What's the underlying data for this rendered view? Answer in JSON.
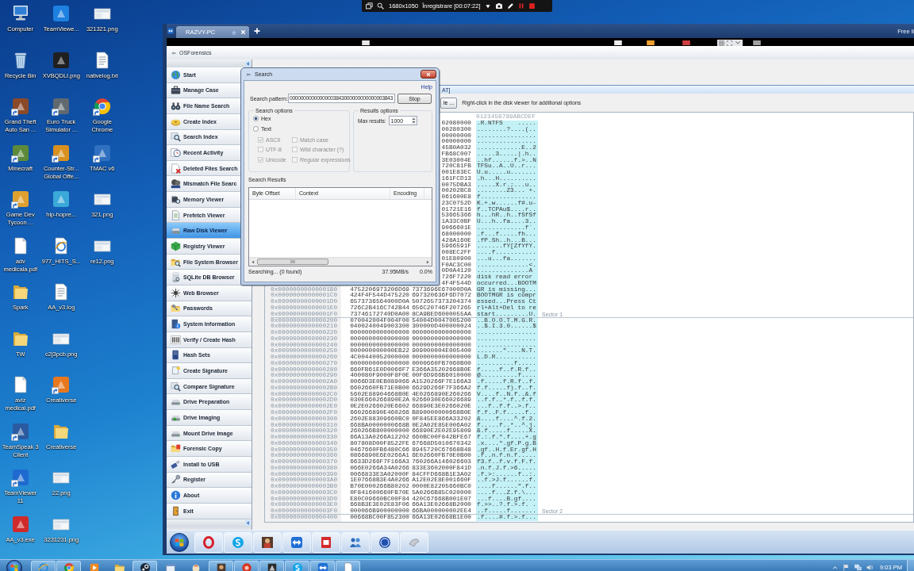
{
  "recording_bar": {
    "resolution": "1680x1050",
    "status": "Înregistrare [00:07:22]"
  },
  "desktop": {
    "columns": [
      {
        "icons": [
          {
            "label": "Computer",
            "kind": "computer",
            "shortcut": false
          },
          {
            "label": "Recycle Bin",
            "kind": "recycle-bin",
            "shortcut": false
          },
          {
            "label": "Grand Theft Auto San ...",
            "kind": "app",
            "color": "#8a4a2a",
            "shortcut": true
          },
          {
            "label": "Minecraft",
            "kind": "app",
            "color": "#5c8a3a",
            "shortcut": true
          },
          {
            "label": "Game Dev Tycoon ...",
            "kind": "app",
            "color": "#e0a030",
            "shortcut": true
          },
          {
            "label": "adv medicala.pdf",
            "kind": "blank-file",
            "shortcut": false
          },
          {
            "label": "Spark",
            "kind": "folder",
            "shortcut": false
          },
          {
            "label": "TW",
            "kind": "folder",
            "shortcut": false
          },
          {
            "label": "aviz medical.pdf",
            "kind": "blank-file",
            "shortcut": false
          },
          {
            "label": "TeamSpeak 3 Client",
            "kind": "app",
            "color": "#2a5aa0",
            "shortcut": true
          },
          {
            "label": "TeamViewer 11",
            "kind": "app",
            "color": "#1e6ad0",
            "shortcut": true
          },
          {
            "label": "AA_v3.exe",
            "kind": "app",
            "color": "#d02a2a",
            "shortcut": false
          }
        ]
      },
      {
        "icons": [
          {
            "label": "TeamViewe...",
            "kind": "app",
            "color": "#1e80e0",
            "shortcut": false
          },
          {
            "label": "XVBQDLI.png",
            "kind": "app",
            "color": "#202020",
            "shortcut": false
          },
          {
            "label": "Euro Truck Simulator ...",
            "kind": "app",
            "color": "#606870",
            "shortcut": true
          },
          {
            "label": "Counter-Str... Global Offe...",
            "kind": "app",
            "color": "#d89020",
            "shortcut": true
          },
          {
            "label": "hip-hopre...",
            "kind": "app",
            "color": "#3aa8d8",
            "shortcut": false
          },
          {
            "label": "977_HITS_S...",
            "kind": "web-file",
            "shortcut": false
          },
          {
            "label": "AA_v3.log",
            "kind": "text-file",
            "shortcut": false
          },
          {
            "label": "c2j3pcb.png",
            "kind": "image-file",
            "shortcut": false
          },
          {
            "label": "Creativerse",
            "kind": "app",
            "color": "#e87820",
            "shortcut": true
          },
          {
            "label": "Creativerse",
            "kind": "folder",
            "shortcut": false
          },
          {
            "label": "22.png",
            "kind": "image-file",
            "shortcut": false
          },
          {
            "label": "3231231.png",
            "kind": "image-file",
            "shortcut": false
          }
        ]
      },
      {
        "icons": [
          {
            "label": "321321.png",
            "kind": "image-file",
            "shortcut": false
          },
          {
            "label": "nativelog.txt",
            "kind": "text-file",
            "shortcut": false
          },
          {
            "label": "Google Chrome",
            "kind": "chrome",
            "shortcut": true
          },
          {
            "label": "TMAC v6",
            "kind": "app",
            "color": "#3070c0",
            "shortcut": true
          },
          {
            "label": "321.png",
            "kind": "image-file",
            "shortcut": false
          },
          {
            "label": "re12.png",
            "kind": "image-file",
            "shortcut": false
          }
        ]
      }
    ]
  },
  "remote_window": {
    "tabs": [
      {
        "label": "RAZVY-PC",
        "selected": true
      }
    ],
    "license_notice": "Free li",
    "app": {
      "title": "OSForensics",
      "sidebar": [
        {
          "label": "Start",
          "selected": false
        },
        {
          "label": "Manage Case",
          "selected": false
        },
        {
          "label": "File Name Search",
          "selected": false
        },
        {
          "label": "Create Index",
          "selected": false
        },
        {
          "label": "Search Index",
          "selected": false
        },
        {
          "label": "Recent Activity",
          "selected": false
        },
        {
          "label": "Deleted Files Search",
          "selected": false
        },
        {
          "label": "Mismatch File Searc",
          "selected": false
        },
        {
          "label": "Memory Viewer",
          "selected": false
        },
        {
          "label": "Prefetch Viewer",
          "selected": false
        },
        {
          "label": "Raw Disk Viewer",
          "selected": true
        },
        {
          "label": "Registry Viewer",
          "selected": false
        },
        {
          "label": "File System Browser",
          "selected": false
        },
        {
          "label": "SQLite DB Browser",
          "selected": false
        },
        {
          "label": "Web Browser",
          "selected": false
        },
        {
          "label": "Passwords",
          "selected": false
        },
        {
          "label": "System Information",
          "selected": false
        },
        {
          "label": "Verify / Create Hash",
          "selected": false
        },
        {
          "label": "Hash Sets",
          "selected": false
        },
        {
          "label": "Create Signature",
          "selected": false
        },
        {
          "label": "Compare Signature",
          "selected": false
        },
        {
          "label": "Drive Preparation",
          "selected": false
        },
        {
          "label": "Drive Imaging",
          "selected": false
        },
        {
          "label": "Mount Drive Image",
          "selected": false
        },
        {
          "label": "Forensic Copy",
          "selected": false
        },
        {
          "label": "Install to USB",
          "selected": false
        },
        {
          "label": "Register",
          "selected": false
        },
        {
          "label": "About",
          "selected": false
        },
        {
          "label": "Exit",
          "selected": false
        }
      ],
      "viewer_title": "AT]",
      "toolbar_button": "le ...",
      "toolbar_hint": "Right-click in the disk viewer for additional options",
      "hex_view": {
        "header": "0123456789ABCDEF",
        "rows": [
          {
            "hex_2": "02080000",
            "ascii": ".R.NTFS    ....."
          },
          {
            "hex_2": "00280300",
            "ascii": "........?....(.."
          },
          {
            "hex_2": "00000000",
            "ascii": "................"
          },
          {
            "hex_2": "00000000",
            "ascii": "................"
          },
          {
            "hex_2": "45B0A032",
            "ascii": "............E..2"
          },
          {
            "hex_2": "FB68C007",
            "ascii": ".....3.....|.h.."
          },
          {
            "hex_2": "3E03004E",
            "ascii": "..hf......f.>..N"
          },
          {
            "hex_2": "720C81FB",
            "ascii": "TFSu..A..U..r..."
          },
          {
            "hex_2": "001E83EC",
            "ascii": "U.u.....u......."
          },
          {
            "hex_2": "161FCD13",
            "ascii": ".h...H.........."
          },
          {
            "hex_2": "0075DBA3",
            "ascii": ".....X.r.;...u.."
          },
          {
            "hex_2": "00202BC8",
            "ascii": "........Z3... +."
          },
          {
            "hex_2": "061600E8",
            "ascii": "f..............."
          },
          {
            "hex_2": "23C0752D",
            "ascii": "K.+.w......f#.u-"
          },
          {
            "hex_2": "01721E16",
            "ascii": "f..TCPAu$....r.."
          },
          {
            "hex_2": "53665366",
            "ascii": "h...hR..h..fSfSf"
          },
          {
            "hex_2": "1A33C0BF",
            "ascii": "U...h..fa....3.."
          },
          {
            "hex_2": "9066601E",
            "ascii": ".............f`."
          },
          {
            "hex_2": "68000000",
            "ascii": ".f...f.....fh..."
          },
          {
            "hex_2": "428A160E",
            "ascii": ".fP.Sh..h...B..."
          },
          {
            "hex_2": "5966591F",
            "ascii": ".......fY[ZfYfY."
          },
          {
            "hex_2": "008EC2FF",
            "ascii": "....f..........."
          },
          {
            "hex_2": "01E80900",
            "ascii": "...u...fa......."
          },
          {
            "hex_2": "F0AC3C00",
            "ascii": "..............<."
          },
          {
            "hex_2": "0D0A4120",
            "ascii": "..............A "
          },
          {
            "hex_2": "726F7220",
            "ascii": "disk read error "
          },
          {
            "hex_2": "4F4F544D",
            "ascii": "occurred...BOOTM"
          },
          {
            "offset": "0x00000000000001B0",
            "hex_1": "4752206973206D69",
            "hex_2": "7373696E67000D0A",
            "ascii": "GR is missing..."
          },
          {
            "offset": "0x00000000000001C0",
            "hex_1": "424F4F544D475220",
            "hex_2": "697320636F6D7072",
            "ascii": "BOOTMGR is compr"
          },
          {
            "offset": "0x00000000000001D0",
            "hex_1": "6573736564000D0A",
            "hex_2": "5072657373204374",
            "ascii": "essed...Press Ct"
          },
          {
            "offset": "0x00000000000001E0",
            "hex_1": "726C2B416C742B44",
            "hex_2": "656C20746F207265",
            "ascii": "rl+Alt+Del to re"
          },
          {
            "offset": "0x00000000000001F0",
            "hex_1": "73746172740D0A00",
            "hex_2": "8CA9BED6000055AA",
            "ascii": "start.........U.",
            "sector_label": "Sector 1"
          },
          {
            "offset": "0x0000000000000200",
            "hex_1": "070042004F004F00",
            "hex_2": "54004D0047005200",
            "ascii": "..B.O.O.T.M.G.R."
          },
          {
            "offset": "0x0000000000000210",
            "hex_1": "0400240049003300",
            "hex_2": "300000D400000024",
            "ascii": "..$.I.3.0......$"
          },
          {
            "offset": "0x0000000000000220",
            "hex_1": "0000000000000000",
            "hex_2": "0000000000000000",
            "ascii": "................"
          },
          {
            "offset": "0x0000000000000230",
            "hex_1": "0000000000000000",
            "hex_2": "0000000000000000",
            "ascii": "................"
          },
          {
            "offset": "0x0000000000000240",
            "hex_1": "0000000000000000",
            "hex_2": "0000000000000000",
            "ascii": "................"
          },
          {
            "offset": "0x0000000000000250",
            "hex_1": "000000000000EB22",
            "hex_2": "909000004E005400",
            "ascii": ".......\"....N.T."
          },
          {
            "offset": "0x0000000000000260",
            "hex_1": "4C00440052000000",
            "hex_2": "0000000000000000",
            "ascii": "L.D.R..........."
          },
          {
            "offset": "0x0000000000000270",
            "hex_1": "0000000000000000",
            "hex_2": "0000660FB7060B00",
            "ascii": "..........f....."
          },
          {
            "offset": "0x0000000000000280",
            "hex_1": "660FB61E0D0066F7",
            "hex_2": "E366A35202668B0E",
            "ascii": "f.....f..f.R.f.."
          },
          {
            "offset": "0x0000000000000290",
            "hex_1": "400080F9000F8F0E",
            "hex_2": "00F6D966B6010000",
            "ascii": "@..........f...."
          },
          {
            "offset": "0x00000000000002A0",
            "hex_1": "0066D3E0EB089066",
            "hex_2": "A1520266F7E166A3",
            "ascii": ".f.....f.R.f..f."
          },
          {
            "offset": "0x00000000000002B0",
            "hex_1": "6602660FB71E0B00",
            "hex_2": "6629D266F7F366A2",
            "ascii": "f.f.....f).f..f."
          },
          {
            "offset": "0x00000000000002C0",
            "hex_1": "5602E88904668B0E",
            "hex_2": "4E0266890E260266",
            "ascii": "V....f..N.f..&.f"
          },
          {
            "offset": "0x00000000000002D0",
            "hex_1": "030E660266890E2A",
            "hex_2": "0266030E66026689",
            "ascii": "..f.f..*.f..f.f."
          },
          {
            "offset": "0x00000000000002E0",
            "hex_1": "0E2E0266020E6602",
            "hex_2": "66890E3E0266020E",
            "ascii": "...f..f.f..>.f.."
          },
          {
            "offset": "0x00000000000002F0",
            "hex_1": "660266890E460266",
            "hex_2": "B890000000668B0E",
            "ascii": "f.f..F.f.....f.."
          },
          {
            "offset": "0x0000000000000300",
            "hex_1": "2602E88309660BC0",
            "hex_2": "0F845EE866A33202",
            "ascii": "&....f....^.f.2."
          },
          {
            "offset": "0x0000000000000310",
            "hex_1": "668BA0000000668B",
            "hex_2": "0E2A02E85E006A02",
            "ascii": "f.....f..*..^.j."
          },
          {
            "offset": "0x0000000000000320",
            "hex_1": "260266B800000000",
            "hex_2": "66890E2E02E95809",
            "ascii": "&.f.....f.....X."
          },
          {
            "offset": "0x0000000000000330",
            "hex_1": "66A13A0266A12202",
            "hex_2": "660BC00F842BFE67",
            "ascii": "f.:.f.\".f....+.g"
          },
          {
            "offset": "0x0000000000000340",
            "hex_1": "807808D00F8522FE",
            "hex_2": "67668D5010670342",
            "ascii": ".x....\".gf.P.g.B"
          },
          {
            "offset": "0x0000000000000350",
            "hex_1": "0467660FB6480C66",
            "hex_2": "8945720C67668B48",
            "ascii": ".gf..H.f.Er.gf.H"
          },
          {
            "offset": "0x0000000000000360",
            "hex_1": "0866890E6E0266A1",
            "hex_2": "6E02660FB70E0B00",
            "ascii": ".f..n.f.n.f....."
          },
          {
            "offset": "0x0000000000000370",
            "hex_1": "6633D266F7F166A3",
            "hex_2": "760266A146026603",
            "ascii": "f3.f..f.v.f.F.f."
          },
          {
            "offset": "0x0000000000000380",
            "hex_1": "066E0266A34A0266",
            "hex_2": "833E3602000F841D",
            "ascii": ".n.f.J.f.>6....."
          },
          {
            "offset": "0x0000000000000390",
            "hex_1": "0066833E3A02000F",
            "hex_2": "84CFFD668B1E3A02",
            "ascii": ".f.>:......f..:."
          },
          {
            "offset": "0x00000000000003A0",
            "hex_1": "1E07668B3E4A0266",
            "hex_2": "A12E02E8E001660F",
            "ascii": "..f.>J.f......f."
          },
          {
            "offset": "0x00000000000003B0",
            "hex_1": "B70E000266B80202",
            "hex_2": "0000E82205660BC0",
            "ascii": "....f......\".f.."
          },
          {
            "offset": "0x00000000000003C0",
            "hex_1": "0F841600660FB70E",
            "hex_2": "5A0266B85C020000",
            "ascii": "....f...Z.f.\\..."
          },
          {
            "offset": "0x00000000000003D0",
            "hex_1": "E80C09660BC00F84",
            "hex_2": "420C67668B001E07",
            "ascii": "...f....B.gf...."
          },
          {
            "offset": "0x00000000000003E0",
            "hex_1": "668B3E3E02E83F06",
            "hex_2": "66A13E02668B2000",
            "ascii": "f.>>..?.f.>.f. ."
          },
          {
            "offset": "0x00000000000003F0",
            "hex_1": "000066B900000000",
            "hex_2": "66BA000000002EE4",
            "ascii": "..f.....f.......",
            "sector_label": "Sector 2"
          },
          {
            "offset": "0x0000000000000400",
            "hex_1": "00668BC00F852300",
            "hex_2": "66A13E02668B1E00",
            "ascii": ".f....#.f.>.f..."
          }
        ]
      }
    }
  },
  "search_dialog": {
    "title": "Search",
    "help_link": "Help",
    "pattern_label": "Search pattern:",
    "pattern_value": "00000000000000003843000000000000003843",
    "stop_button": "Stop",
    "search_options": {
      "legend": "Search options",
      "modes": [
        {
          "label": "Hex",
          "selected": true
        },
        {
          "label": "Text",
          "selected": false
        }
      ],
      "checkboxes": [
        {
          "label": "ASCII",
          "checked": true,
          "disabled": true
        },
        {
          "label": "Match case",
          "checked": false,
          "disabled": true
        },
        {
          "label": "UTF-8",
          "checked": false,
          "disabled": true
        },
        {
          "label": "Wild character (?)",
          "checked": false,
          "disabled": true
        },
        {
          "label": "Unicode",
          "checked": true,
          "disabled": true
        },
        {
          "label": "Regular expressions",
          "checked": false,
          "disabled": true
        }
      ]
    },
    "results_options": {
      "legend": "Results options",
      "max_results_label": "Max results:",
      "max_results_value": "1000"
    },
    "results_label": "Search Results",
    "columns": [
      "Byte Offset",
      "Context",
      "Encoding"
    ],
    "status": "Searching... (0 found)",
    "speed": "37.95MB/s",
    "progress": "0.0%"
  },
  "taskbar": {
    "buttons": [
      {
        "running": true
      },
      {
        "running": true
      },
      {
        "running": false
      },
      {
        "running": false
      },
      {
        "running": true
      },
      {
        "running": false
      },
      {
        "running": false
      },
      {
        "running": true
      },
      {
        "running": true
      },
      {
        "running": true
      },
      {
        "running": true
      },
      {
        "running": true
      },
      {
        "running": true
      }
    ],
    "clock": "9:03 PM"
  }
}
